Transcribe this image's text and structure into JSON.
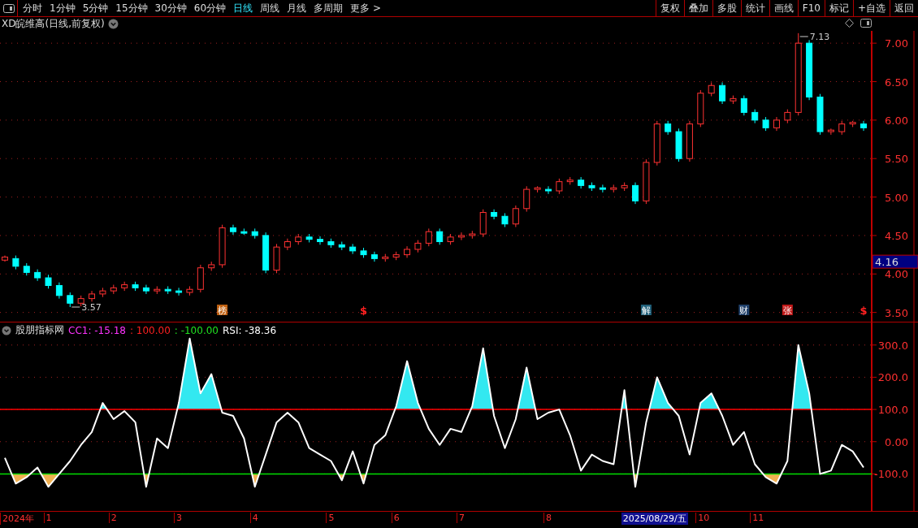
{
  "toolbar": {
    "periods": [
      {
        "label": "分时",
        "selected": false
      },
      {
        "label": "1分钟",
        "selected": false
      },
      {
        "label": "5分钟",
        "selected": false
      },
      {
        "label": "15分钟",
        "selected": false
      },
      {
        "label": "30分钟",
        "selected": false
      },
      {
        "label": "60分钟",
        "selected": false
      },
      {
        "label": "日线",
        "selected": true
      },
      {
        "label": "周线",
        "selected": false
      },
      {
        "label": "月线",
        "selected": false
      },
      {
        "label": "多周期",
        "selected": false
      },
      {
        "label": "更多 >",
        "selected": false
      }
    ],
    "buttons": [
      "复权",
      "叠加",
      "多股",
      "统计",
      "画线",
      "F10",
      "标记",
      "+自选",
      "返回"
    ]
  },
  "price_panel": {
    "title": "XD皖维高(日线,前复权)",
    "cursor_price": "4.16",
    "events": [
      {
        "label": "榜",
        "kind": "boxed",
        "color": "#c06010"
      },
      {
        "label": "$",
        "kind": "plain",
        "color": "#ff2020"
      },
      {
        "label": "解",
        "kind": "boxed",
        "color": "#20607a"
      },
      {
        "label": "财",
        "kind": "boxed",
        "color": "#20406a"
      },
      {
        "label": "张",
        "kind": "boxed",
        "color": "#c01818"
      },
      {
        "label": "$",
        "kind": "plain",
        "color": "#ff2020"
      }
    ],
    "chart_data": {
      "type": "candlestick",
      "grid": true,
      "ylim": [
        3.38,
        7.16
      ],
      "yticks": [
        {
          "value": 3.5,
          "label": "3.50"
        },
        {
          "value": 4,
          "label": "4.00"
        },
        {
          "value": 4.5,
          "label": "4.50"
        },
        {
          "value": 5,
          "label": "5.00"
        },
        {
          "value": 5.5,
          "label": "5.50"
        },
        {
          "value": 6,
          "label": "6.00"
        },
        {
          "value": 6.5,
          "label": "6.50"
        },
        {
          "value": 7,
          "label": "7.00"
        }
      ],
      "ohlc": [
        [
          4.18,
          4.24,
          4.16,
          4.22
        ],
        [
          4.2,
          4.24,
          4.06,
          4.1
        ],
        [
          4.1,
          4.14,
          3.98,
          4.02
        ],
        [
          4.02,
          4.06,
          3.91,
          3.95
        ],
        [
          3.95,
          3.99,
          3.81,
          3.85
        ],
        [
          3.85,
          3.89,
          3.68,
          3.72
        ],
        [
          3.72,
          3.76,
          3.57,
          3.62
        ],
        [
          3.62,
          3.72,
          3.58,
          3.68
        ],
        [
          3.68,
          3.78,
          3.64,
          3.74
        ],
        [
          3.74,
          3.82,
          3.7,
          3.78
        ],
        [
          3.78,
          3.86,
          3.74,
          3.82
        ],
        [
          3.82,
          3.9,
          3.78,
          3.86
        ],
        [
          3.86,
          3.9,
          3.78,
          3.82
        ],
        [
          3.82,
          3.86,
          3.74,
          3.78
        ],
        [
          3.78,
          3.84,
          3.74,
          3.8
        ],
        [
          3.8,
          3.84,
          3.74,
          3.78
        ],
        [
          3.78,
          3.82,
          3.72,
          3.76
        ],
        [
          3.76,
          3.84,
          3.72,
          3.8
        ],
        [
          3.8,
          4.12,
          3.76,
          4.08
        ],
        [
          4.08,
          4.16,
          4.04,
          4.12
        ],
        [
          4.12,
          4.64,
          4.08,
          4.6
        ],
        [
          4.6,
          4.64,
          4.51,
          4.55
        ],
        [
          4.55,
          4.59,
          4.51,
          4.53
        ],
        [
          4.55,
          4.59,
          4.46,
          4.5
        ],
        [
          4.5,
          4.54,
          4.01,
          4.05
        ],
        [
          4.05,
          4.39,
          4.01,
          4.35
        ],
        [
          4.35,
          4.46,
          4.31,
          4.42
        ],
        [
          4.42,
          4.52,
          4.38,
          4.48
        ],
        [
          4.48,
          4.52,
          4.41,
          4.45
        ],
        [
          4.45,
          4.49,
          4.38,
          4.42
        ],
        [
          4.42,
          4.46,
          4.34,
          4.38
        ],
        [
          4.38,
          4.42,
          4.31,
          4.35
        ],
        [
          4.35,
          4.39,
          4.26,
          4.3
        ],
        [
          4.3,
          4.34,
          4.21,
          4.25
        ],
        [
          4.25,
          4.29,
          4.16,
          4.2
        ],
        [
          4.2,
          4.26,
          4.16,
          4.22
        ],
        [
          4.22,
          4.29,
          4.18,
          4.25
        ],
        [
          4.25,
          4.36,
          4.21,
          4.32
        ],
        [
          4.32,
          4.44,
          4.28,
          4.4
        ],
        [
          4.4,
          4.59,
          4.36,
          4.55
        ],
        [
          4.55,
          4.59,
          4.38,
          4.42
        ],
        [
          4.42,
          4.52,
          4.38,
          4.48
        ],
        [
          4.48,
          4.54,
          4.44,
          4.5
        ],
        [
          4.5,
          4.56,
          4.46,
          4.52
        ],
        [
          4.52,
          4.84,
          4.48,
          4.8
        ],
        [
          4.8,
          4.84,
          4.71,
          4.75
        ],
        [
          4.75,
          4.79,
          4.61,
          4.65
        ],
        [
          4.65,
          4.89,
          4.61,
          4.85
        ],
        [
          4.85,
          5.14,
          4.81,
          5.1
        ],
        [
          5.1,
          5.14,
          5.06,
          5.12
        ],
        [
          5.1,
          5.14,
          5.04,
          5.08
        ],
        [
          5.08,
          5.24,
          5.04,
          5.2
        ],
        [
          5.2,
          5.26,
          5.16,
          5.22
        ],
        [
          5.22,
          5.26,
          5.11,
          5.15
        ],
        [
          5.15,
          5.19,
          5.08,
          5.12
        ],
        [
          5.12,
          5.16,
          5.06,
          5.1
        ],
        [
          5.1,
          5.16,
          5.06,
          5.12
        ],
        [
          5.12,
          5.19,
          5.08,
          5.15
        ],
        [
          5.15,
          5.19,
          4.91,
          4.95
        ],
        [
          4.95,
          5.49,
          4.91,
          5.45
        ],
        [
          5.45,
          5.99,
          5.41,
          5.95
        ],
        [
          5.95,
          5.99,
          5.81,
          5.85
        ],
        [
          5.85,
          5.89,
          5.46,
          5.5
        ],
        [
          5.5,
          5.99,
          5.46,
          5.95
        ],
        [
          5.95,
          6.39,
          5.91,
          6.35
        ],
        [
          6.35,
          6.49,
          6.31,
          6.45
        ],
        [
          6.45,
          6.49,
          6.21,
          6.25
        ],
        [
          6.25,
          6.32,
          6.21,
          6.28
        ],
        [
          6.28,
          6.32,
          6.06,
          6.1
        ],
        [
          6.1,
          6.14,
          5.96,
          6.0
        ],
        [
          6.0,
          6.04,
          5.86,
          5.9
        ],
        [
          5.9,
          6.04,
          5.86,
          6.0
        ],
        [
          6.0,
          6.14,
          5.96,
          6.1
        ],
        [
          6.1,
          7.13,
          6.06,
          7.0
        ],
        [
          7.0,
          7.04,
          6.26,
          6.3
        ],
        [
          6.3,
          6.34,
          5.81,
          5.85
        ],
        [
          5.85,
          5.89,
          5.81,
          5.87
        ],
        [
          5.85,
          5.99,
          5.81,
          5.95
        ],
        [
          5.95,
          5.99,
          5.91,
          5.97
        ],
        [
          5.95,
          5.99,
          5.86,
          5.9
        ]
      ],
      "annotations": [
        "3.57",
        "7.13"
      ]
    }
  },
  "indicator_panel": {
    "name": "股朋指标网",
    "legend": [
      {
        "text": "CC1: -15.18",
        "color": "#ff33ff"
      },
      {
        "text": ": 100.00",
        "color": "#ff2020"
      },
      {
        "text": ": -100.00",
        "color": "#20e020"
      },
      {
        "text": "RSI: -38.36",
        "color": "#ffffff"
      }
    ],
    "chart_data": {
      "type": "line",
      "grid": true,
      "ylim": [
        -215,
        370
      ],
      "yticks": [
        {
          "value": -100,
          "label": "-100.0"
        },
        {
          "value": 0,
          "label": "0.00"
        },
        {
          "value": 100,
          "label": "100.0"
        },
        {
          "value": 200,
          "label": "200.0"
        },
        {
          "value": 300,
          "label": "300.0"
        }
      ],
      "ref_lines": [
        {
          "axis": "y",
          "value": 100,
          "color": "#ff0000"
        },
        {
          "axis": "y",
          "value": -100,
          "color": "#00dd00"
        }
      ],
      "series": [
        {
          "color": "#ffffff",
          "values": [
            -50,
            -130,
            -110,
            -80,
            -140,
            -100,
            -60,
            -10,
            30,
            120,
            70,
            95,
            60,
            -140,
            10,
            -20,
            120,
            320,
            150,
            210,
            90,
            80,
            10,
            -140,
            -40,
            60,
            90,
            60,
            -20,
            -40,
            -60,
            -120,
            -30,
            -130,
            -10,
            20,
            110,
            250,
            120,
            40,
            -10,
            40,
            30,
            110,
            290,
            80,
            -20,
            70,
            230,
            70,
            90,
            100,
            20,
            -90,
            -40,
            -60,
            -70,
            160,
            -140,
            60,
            200,
            120,
            80,
            -40,
            120,
            150,
            80,
            -10,
            30,
            -70,
            -110,
            -130,
            -60,
            300,
            150,
            -100,
            -90,
            -10,
            -30,
            -80
          ]
        }
      ]
    }
  },
  "time_axis": {
    "labels": [
      "2024年",
      "1",
      "2",
      "3",
      "4",
      "5",
      "6",
      "7",
      "8",
      "10",
      "11"
    ],
    "cursor_label": "2025/08/29/五"
  }
}
